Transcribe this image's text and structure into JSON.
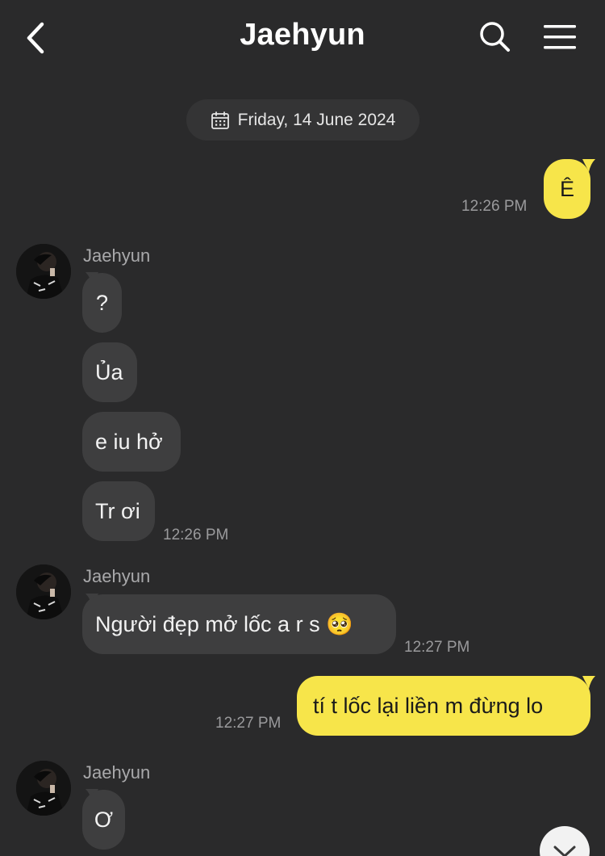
{
  "header": {
    "title": "Jaehyun",
    "back_icon": "chevron-left-icon",
    "search_icon": "search-icon",
    "menu_icon": "hamburger-menu-icon"
  },
  "date_divider": {
    "icon": "calendar-icon",
    "label": "Friday, 14 June 2024"
  },
  "colors": {
    "background": "#2a2a2b",
    "incoming_bubble": "#3e3e3f",
    "outgoing_bubble": "#f7e54a",
    "timestamp": "#9a9a9c"
  },
  "messages": [
    {
      "direction": "out",
      "text": "Ê",
      "time": "12:26 PM"
    },
    {
      "direction": "in",
      "sender": "Jaehyun",
      "texts": [
        "?",
        "Ủa",
        "e iu hở",
        "Tr ơi"
      ],
      "time": "12:26 PM"
    },
    {
      "direction": "in",
      "sender": "Jaehyun",
      "texts": [
        "Người đẹp mở lốc a r s 🥺"
      ],
      "time": "12:27 PM"
    },
    {
      "direction": "out",
      "text": "tí t lốc lại liền m đừng lo",
      "time": "12:27 PM"
    },
    {
      "direction": "in",
      "sender": "Jaehyun",
      "texts": [
        "Ơ"
      ]
    }
  ],
  "scroll_down_icon": "chevron-down-icon"
}
